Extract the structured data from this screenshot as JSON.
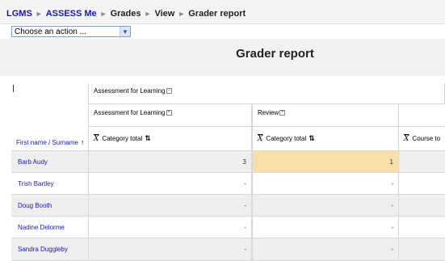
{
  "breadcrumb": {
    "items": [
      "LGMS",
      "ASSESS Me",
      "Grades",
      "View",
      "Grader report"
    ],
    "separator": "►"
  },
  "action_select": {
    "value": "Choose an action ..."
  },
  "page_title": "Grader report",
  "grid": {
    "top_category": "Assessment for Learning",
    "top_toggle": "−",
    "sub_categories": [
      {
        "label": "Assessment for Learning",
        "toggle": "+"
      },
      {
        "label": "Review",
        "toggle": "+"
      }
    ],
    "column_headers": {
      "name": "First name / Surname",
      "cat_total_1": "Category total",
      "cat_total_2": "Category total",
      "course_total": "Course to"
    },
    "xbar_symbol": "X",
    "rows": [
      {
        "name": "Barb Audy",
        "c1": "3",
        "c2": "1"
      },
      {
        "name": "Trish Bartley",
        "c1": "-",
        "c2": "-"
      },
      {
        "name": "Doug Booth",
        "c1": "-",
        "c2": "-"
      },
      {
        "name": "Nadine Delorme",
        "c1": "-",
        "c2": "-"
      },
      {
        "name": "Sandra Duggleby",
        "c1": "-",
        "c2": "-"
      }
    ]
  },
  "colors": {
    "link": "#1a1aa6",
    "highlight": "#f7dfaa",
    "alt_row": "#eeeeee"
  }
}
